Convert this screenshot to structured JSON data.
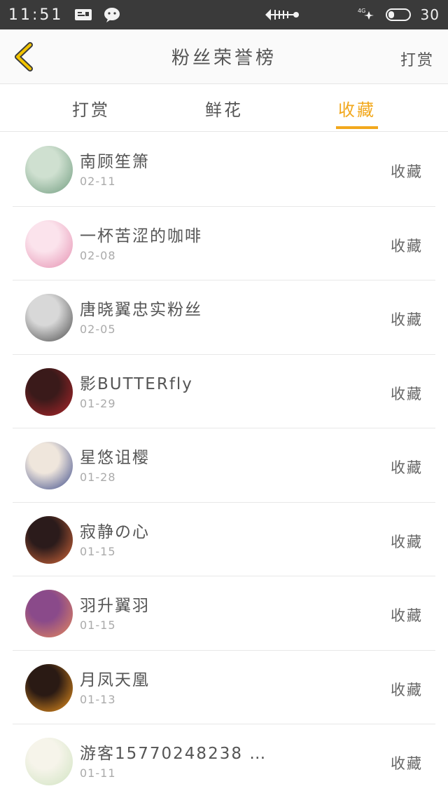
{
  "status_bar": {
    "time": "11:51",
    "battery_level": "30",
    "battery_fraction": 0.3
  },
  "nav": {
    "title": "粉丝荣誉榜",
    "action_label": "打赏"
  },
  "tabs": [
    {
      "label": "打赏",
      "active": false
    },
    {
      "label": "鲜花",
      "active": false
    },
    {
      "label": "收藏",
      "active": true
    }
  ],
  "colors": {
    "accent": "#f2a81d",
    "status_bar": "#3a3a3a"
  },
  "fans": [
    {
      "name": "南顾笙箫",
      "date": "02-11",
      "type": "收藏",
      "avatar_colors": [
        "#cfe0d0",
        "#6f9b7e"
      ]
    },
    {
      "name": "一杯苦涩的咖啡",
      "date": "02-08",
      "type": "收藏",
      "avatar_colors": [
        "#fbe3ec",
        "#e58fb0"
      ]
    },
    {
      "name": "唐晓翼忠实粉丝",
      "date": "02-05",
      "type": "收藏",
      "avatar_colors": [
        "#d8d8d8",
        "#4a4a4a"
      ]
    },
    {
      "name": "影BUTTERfly",
      "date": "01-29",
      "type": "收藏",
      "avatar_colors": [
        "#3a1a1a",
        "#b3262b"
      ]
    },
    {
      "name": "星悠诅樱",
      "date": "01-28",
      "type": "收藏",
      "avatar_colors": [
        "#efe6dc",
        "#3b4a8a"
      ]
    },
    {
      "name": "寂静の心",
      "date": "01-15",
      "type": "收藏",
      "avatar_colors": [
        "#2b1b1b",
        "#d96a3b"
      ]
    },
    {
      "name": "羽升翼羽",
      "date": "01-15",
      "type": "收藏",
      "avatar_colors": [
        "#8a4a8a",
        "#e98a5b"
      ]
    },
    {
      "name": "月凤天凰",
      "date": "01-13",
      "type": "收藏",
      "avatar_colors": [
        "#2a1a14",
        "#f0961e"
      ]
    },
    {
      "name": "游客15770248238 …",
      "date": "01-11",
      "type": "收藏",
      "avatar_colors": [
        "#f6f4ea",
        "#cfe3c0"
      ]
    }
  ]
}
